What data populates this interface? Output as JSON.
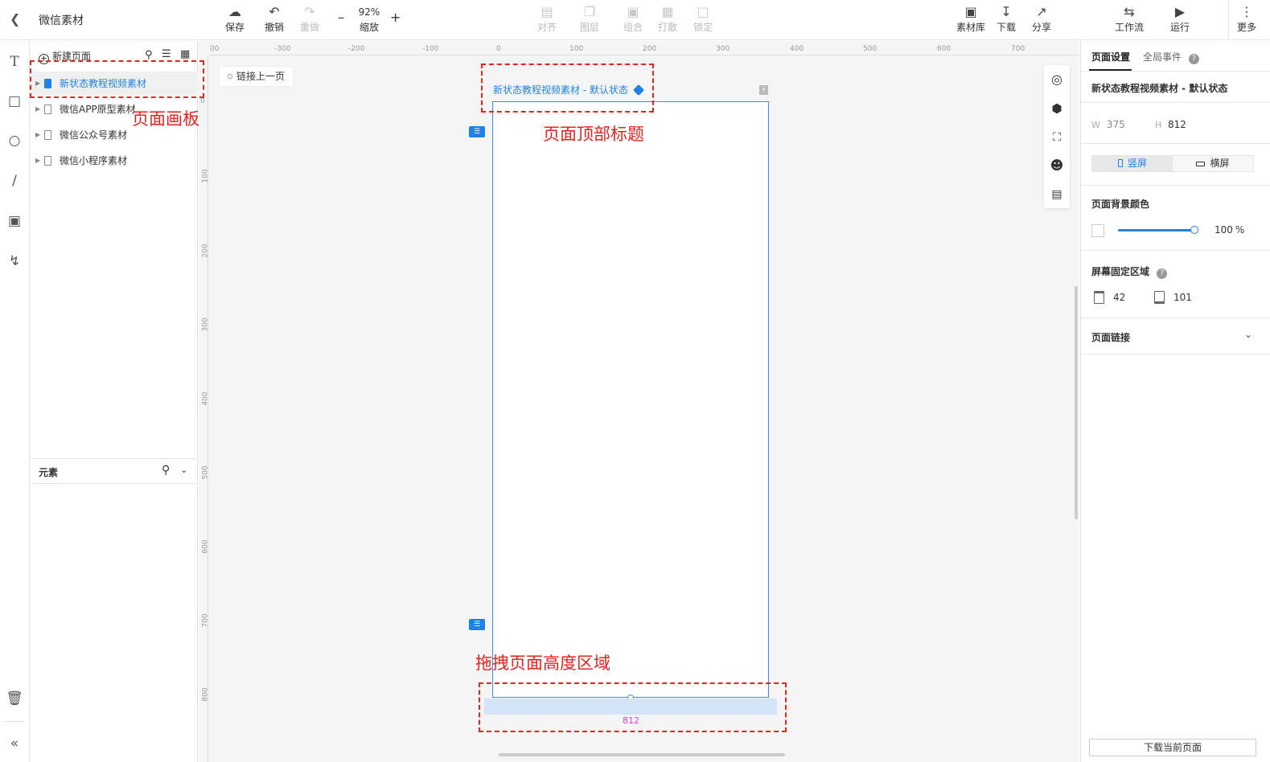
{
  "app": {
    "title": "微信素材"
  },
  "toolbar": {
    "save": "保存",
    "undo": "撤销",
    "redo": "重做",
    "zoom_value": "92%",
    "zoom_label": "缩放",
    "align": "对齐",
    "layer": "图层",
    "group": "组合",
    "ungroup": "打散",
    "lock": "锁定",
    "assets": "素材库",
    "download": "下载",
    "share": "分享",
    "workflow": "工作流",
    "run": "运行",
    "more": "更多"
  },
  "pages_panel": {
    "new_page": "新建页面",
    "pages": [
      "新状态教程视频素材",
      "微信APP原型素材",
      "微信公众号素材",
      "微信小程序素材"
    ],
    "selected_index": 0
  },
  "elements_panel": {
    "title": "元素"
  },
  "canvas": {
    "link_prev": "链接上一页",
    "page_title": "新状态教程视频素材 - 默认状态",
    "height_value": "812",
    "ruler_h": [
      "00",
      "-300",
      "-200",
      "-100",
      "0",
      "100",
      "200",
      "300",
      "400",
      "500",
      "600",
      "700"
    ],
    "ruler_v": [
      "0",
      "100",
      "200",
      "300",
      "400",
      "500",
      "600",
      "700",
      "800"
    ]
  },
  "annotations": {
    "page_board": "页面画板",
    "top_title": "页面顶部标题",
    "drag_height": "拖拽页面高度区域"
  },
  "props_panel": {
    "tab_page": "页面设置",
    "tab_events": "全局事件",
    "page_name": "新状态教程视频素材 - 默认状态",
    "w_label": "W",
    "w_value": "375",
    "h_label": "H",
    "h_value": "812",
    "portrait": "竖屏",
    "landscape": "横屏",
    "bg_color_label": "页面背景颜色",
    "opacity": "100",
    "opacity_unit": "%",
    "fixed_area_label": "屏幕固定区域",
    "fixed_top": "42",
    "fixed_bottom": "101",
    "page_link_label": "页面链接",
    "download_current": "下载当前页面"
  },
  "colors": {
    "accent": "#1e82e6",
    "annotation": "#e8231e",
    "height_value": "#e040e0"
  }
}
